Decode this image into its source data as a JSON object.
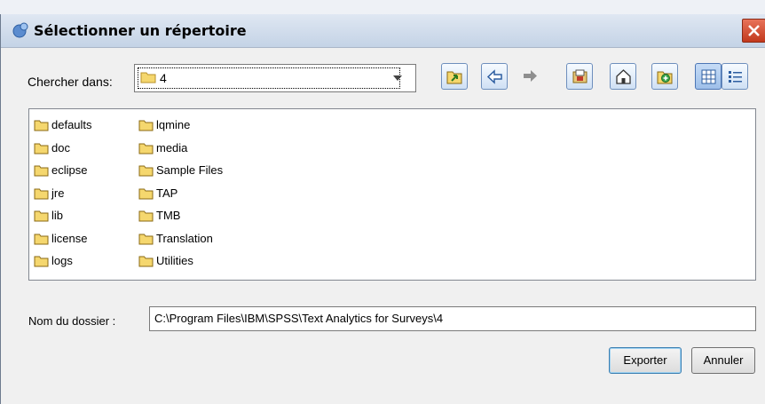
{
  "window": {
    "title": "Sélectionner un répertoire",
    "close_label": "×"
  },
  "look_in": {
    "label": "Chercher dans:",
    "value": "4"
  },
  "toolbar": [
    {
      "icon": "folder-up-icon"
    },
    {
      "icon": "back-arrow-icon"
    },
    {
      "icon": "forward-arrow-icon"
    },
    {
      "icon": "desktop-icon"
    },
    {
      "icon": "home-icon"
    },
    {
      "icon": "new-folder-icon"
    },
    {
      "icon": "list-view-icon",
      "selected": true
    },
    {
      "icon": "details-view-icon"
    }
  ],
  "folders": {
    "col1": [
      "defaults",
      "doc",
      "eclipse",
      "jre",
      "lib",
      "license",
      "logs"
    ],
    "col2": [
      "lqmine",
      "media",
      "Sample Files",
      "TAP",
      "TMB",
      "Translation",
      "Utilities"
    ]
  },
  "folder_name": {
    "label": "Nom du dossier :",
    "value": "C:\\Program Files\\IBM\\SPSS\\Text Analytics for Surveys\\4"
  },
  "buttons": {
    "export": "Exporter",
    "cancel": "Annuler"
  },
  "colors": {
    "folder": "#f5d76e",
    "folder_edge": "#b8902a",
    "title_bar": "#c4d3e6",
    "close": "#d0492b"
  }
}
